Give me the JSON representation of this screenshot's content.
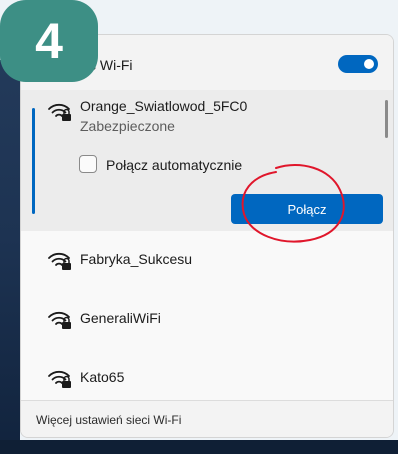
{
  "step_badge": {
    "number": "4",
    "color": "#3d8f85"
  },
  "header": {
    "title": "ć Wi-Fi",
    "toggle_on": true,
    "accent_color": "#0067c0"
  },
  "networks": [
    {
      "name": "Orange_Swiatlowod_5FC0",
      "status": "Zabezpieczone",
      "icon": "wifi-secured-icon",
      "expanded": true,
      "auto_connect_label": "Połącz automatycznie",
      "auto_connect_checked": false,
      "connect_label": "Połącz"
    },
    {
      "name": "Fabryka_Sukcesu",
      "icon": "wifi-secured-icon"
    },
    {
      "name": "GeneraliWiFi",
      "icon": "wifi-secured-icon"
    },
    {
      "name": "Kato65",
      "icon": "wifi-secured-icon"
    }
  ],
  "footer": {
    "link_label": "Więcej ustawień sieci Wi-Fi"
  },
  "annotation": {
    "color": "#e0162b",
    "shape": "hand-drawn circle around connect button"
  }
}
